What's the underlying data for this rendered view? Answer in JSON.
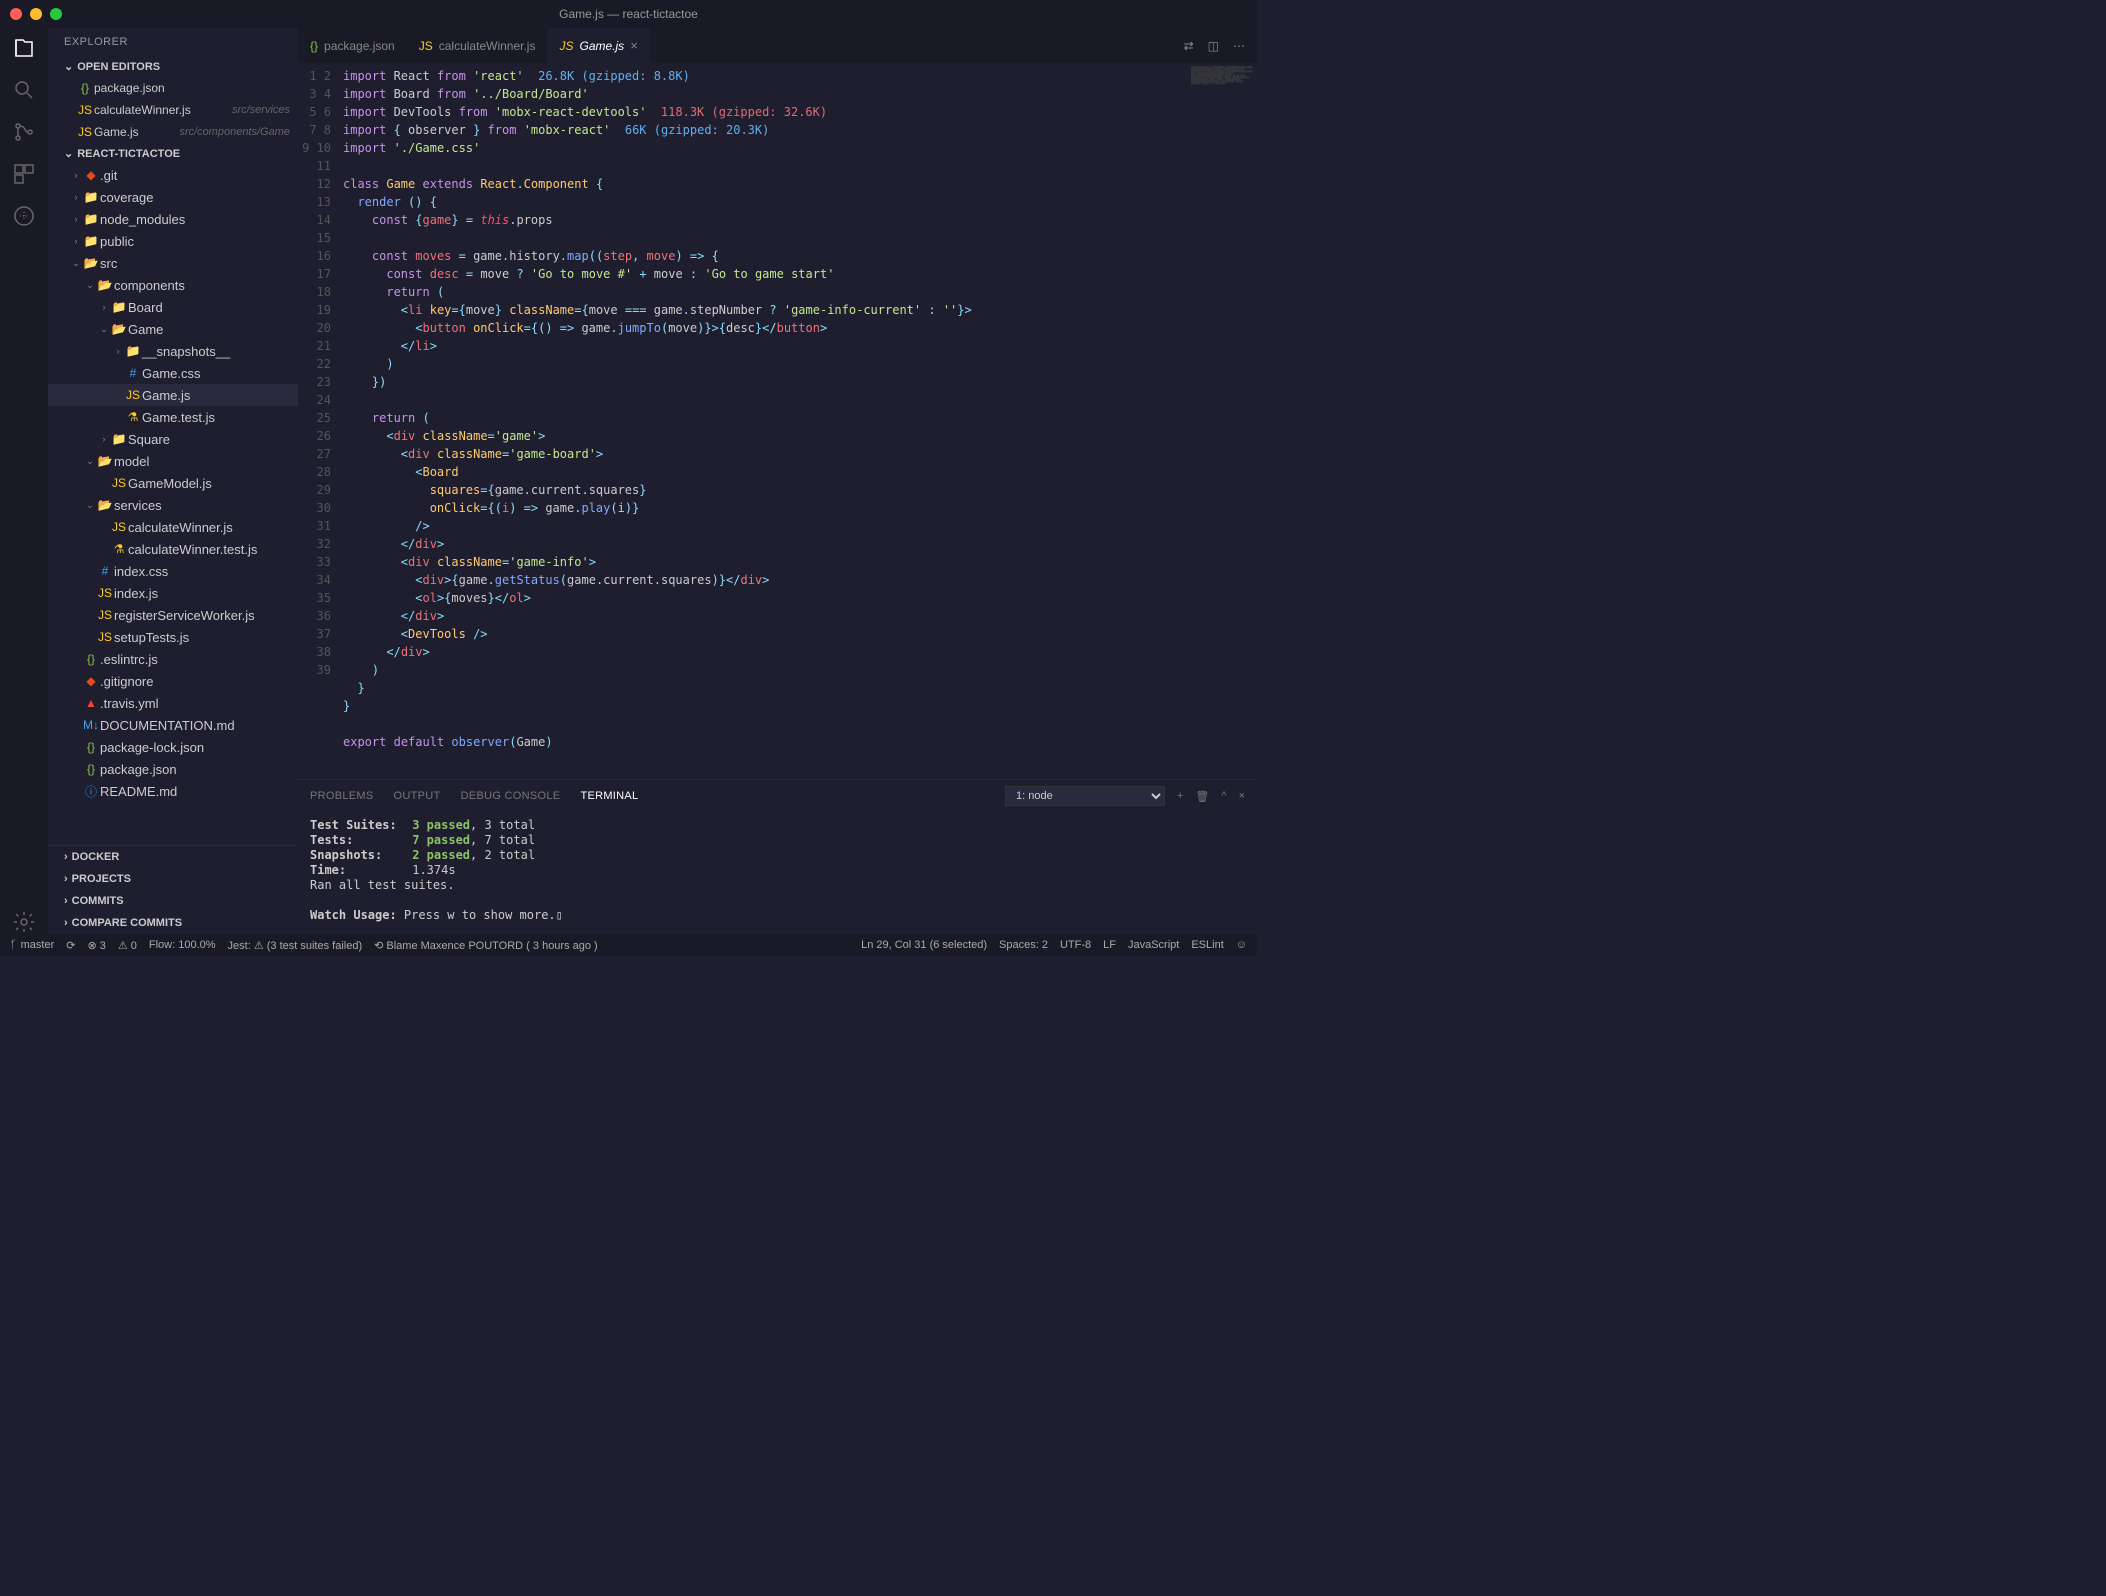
{
  "window_title": "Game.js — react-tictactoe",
  "explorer_title": "EXPLORER",
  "open_editors_title": "OPEN EDITORS",
  "open_editors": [
    {
      "icon": "json",
      "name": "package.json",
      "meta": ""
    },
    {
      "icon": "js",
      "name": "calculateWinner.js",
      "meta": "src/services"
    },
    {
      "icon": "js",
      "name": "Game.js",
      "meta": "src/components/Game"
    }
  ],
  "project_title": "REACT-TICTACTOE",
  "tree": [
    {
      "d": 1,
      "c": "›",
      "i": "git",
      "t": ".git"
    },
    {
      "d": 1,
      "c": "›",
      "i": "folder",
      "t": "coverage"
    },
    {
      "d": 1,
      "c": "›",
      "i": "folder",
      "t": "node_modules"
    },
    {
      "d": 1,
      "c": "›",
      "i": "folder",
      "t": "public"
    },
    {
      "d": 1,
      "c": "⌄",
      "i": "folder-open",
      "t": "src"
    },
    {
      "d": 2,
      "c": "⌄",
      "i": "folder-open",
      "t": "components"
    },
    {
      "d": 3,
      "c": "›",
      "i": "folder",
      "t": "Board"
    },
    {
      "d": 3,
      "c": "⌄",
      "i": "folder-open",
      "t": "Game"
    },
    {
      "d": 4,
      "c": "›",
      "i": "folder",
      "t": "__snapshots__"
    },
    {
      "d": 4,
      "c": "",
      "i": "css",
      "t": "Game.css"
    },
    {
      "d": 4,
      "c": "",
      "i": "js",
      "t": "Game.js",
      "sel": true
    },
    {
      "d": 4,
      "c": "",
      "i": "test",
      "t": "Game.test.js"
    },
    {
      "d": 3,
      "c": "›",
      "i": "folder",
      "t": "Square"
    },
    {
      "d": 2,
      "c": "⌄",
      "i": "folder-open",
      "t": "model"
    },
    {
      "d": 3,
      "c": "",
      "i": "js",
      "t": "GameModel.js"
    },
    {
      "d": 2,
      "c": "⌄",
      "i": "folder-open",
      "t": "services"
    },
    {
      "d": 3,
      "c": "",
      "i": "js",
      "t": "calculateWinner.js"
    },
    {
      "d": 3,
      "c": "",
      "i": "test",
      "t": "calculateWinner.test.js"
    },
    {
      "d": 2,
      "c": "",
      "i": "css",
      "t": "index.css"
    },
    {
      "d": 2,
      "c": "",
      "i": "js",
      "t": "index.js"
    },
    {
      "d": 2,
      "c": "",
      "i": "js",
      "t": "registerServiceWorker.js"
    },
    {
      "d": 2,
      "c": "",
      "i": "js",
      "t": "setupTests.js"
    },
    {
      "d": 1,
      "c": "",
      "i": "json",
      "t": ".eslintrc.js"
    },
    {
      "d": 1,
      "c": "",
      "i": "git",
      "t": ".gitignore"
    },
    {
      "d": 1,
      "c": "",
      "i": "yml",
      "t": ".travis.yml"
    },
    {
      "d": 1,
      "c": "",
      "i": "md",
      "t": "DOCUMENTATION.md"
    },
    {
      "d": 1,
      "c": "",
      "i": "json",
      "t": "package-lock.json"
    },
    {
      "d": 1,
      "c": "",
      "i": "json",
      "t": "package.json"
    },
    {
      "d": 1,
      "c": "",
      "i": "info",
      "t": "README.md"
    }
  ],
  "sidebar_bottom": [
    "DOCKER",
    "PROJECTS",
    "COMMITS",
    "COMPARE COMMITS"
  ],
  "tabs": [
    {
      "icon": "json",
      "label": "package.json"
    },
    {
      "icon": "js",
      "label": "calculateWinner.js"
    },
    {
      "icon": "js",
      "label": "Game.js",
      "active": true,
      "close": true
    }
  ],
  "code_lines": [
    "<span class='kw'>import</span> React <span class='kw'>from</span> <span class='str'>'react'</span>  <span class='hint3'>26.8K (gzipped: 8.8K)</span>",
    "<span class='kw'>import</span> Board <span class='kw'>from</span> <span class='str'>'../Board/Board'</span>",
    "<span class='kw'>import</span> DevTools <span class='kw'>from</span> <span class='str'>'mobx-react-devtools'</span>  <span class='hint2'>118.3K (gzipped: 32.6K)</span>",
    "<span class='kw'>import</span> <span class='op'>{</span> observer <span class='op'>}</span> <span class='kw'>from</span> <span class='str'>'mobx-react'</span>  <span class='hint3'>66K (gzipped: 20.3K)</span>",
    "<span class='kw'>import</span> <span class='str'>'./Game.css'</span>",
    "",
    "<span class='kw'>class</span> <span class='cls'>Game</span> <span class='kw'>extends</span> <span class='cls'>React</span><span class='op'>.</span><span class='cls'>Component</span> <span class='op'>{</span>",
    "  <span class='fn'>render</span> <span class='op'>() {</span>",
    "    <span class='kw'>const</span> <span class='op'>{</span><span class='var'>game</span><span class='op'>}</span> <span class='op'>=</span> <span class='this'>this</span><span class='op'>.</span>props",
    "",
    "    <span class='kw'>const</span> <span class='var'>moves</span> <span class='op'>=</span> game<span class='op'>.</span>history<span class='op'>.</span><span class='fn'>map</span><span class='op'>((</span><span class='var'>step</span><span class='op'>,</span> <span class='var'>move</span><span class='op'>) =&gt; {</span>",
    "      <span class='kw'>const</span> <span class='var'>desc</span> <span class='op'>=</span> move <span class='op'>?</span> <span class='str'>'Go to move #'</span> <span class='op'>+</span> move <span class='op'>:</span> <span class='str'>'Go to game start'</span>",
    "      <span class='kw'>return</span> <span class='op'>(</span>",
    "        <span class='op'>&lt;</span><span class='tag'>li</span> <span class='attr'>key</span><span class='op'>={</span>move<span class='op'>}</span> <span class='attr'>className</span><span class='op'>={</span>move <span class='op'>===</span> game<span class='op'>.</span>stepNumber <span class='op'>?</span> <span class='str'>'game-info-current'</span> <span class='op'>:</span> <span class='str'>''</span><span class='op'>}&gt;</span>",
    "          <span class='op'>&lt;</span><span class='tag'>button</span> <span class='attr'>onClick</span><span class='op'>={() =&gt;</span> game<span class='op'>.</span><span class='fn'>jumpTo</span><span class='op'>(</span>move<span class='op'>)}&gt;{</span>desc<span class='op'>}&lt;/</span><span class='tag'>button</span><span class='op'>&gt;</span>",
    "        <span class='op'>&lt;/</span><span class='tag'>li</span><span class='op'>&gt;</span>",
    "      <span class='op'>)</span>",
    "    <span class='op'>})</span>",
    "",
    "    <span class='kw'>return</span> <span class='op'>(</span>",
    "      <span class='op'>&lt;</span><span class='tag'>div</span> <span class='attr'>className</span><span class='op'>=</span><span class='str'>'game'</span><span class='op'>&gt;</span>",
    "        <span class='op'>&lt;</span><span class='tag'>div</span> <span class='attr'>className</span><span class='op'>=</span><span class='str'>'game-board'</span><span class='op'>&gt;</span>",
    "          <span class='op'>&lt;</span><span class='cls'>Board</span>",
    "            <span class='attr'>squares</span><span class='op'>={</span>game<span class='op'>.</span>current<span class='op'>.</span>squares<span class='op'>}</span>",
    "            <span class='attr'>onClick</span><span class='op'>={(</span><span class='var'>i</span><span class='op'>) =&gt;</span> game<span class='op'>.</span><span class='fn'>play</span><span class='op'>(</span>i<span class='op'>)}</span>",
    "          <span class='op'>/&gt;</span>",
    "        <span class='op'>&lt;/</span><span class='tag'>div</span><span class='op'>&gt;</span>",
    "        <span class='op'>&lt;</span><span class='tag'>div</span> <span class='attr'>className</span><span class='op'>=</span><span class='str'>'game-info'</span><span class='op'>&gt;</span>",
    "          <span class='op'>&lt;</span><span class='tag'>div</span><span class='op'>&gt;{</span>game<span class='op'>.</span><span class='fn'>getStatus</span><span class='op'>(</span>game<span class='op'>.</span>current<span class='op'>.</span>squares<span class='op'>)}&lt;/</span><span class='tag'>div</span><span class='op'>&gt;</span>",
    "          <span class='op'>&lt;</span><span class='tag'>ol</span><span class='op'>&gt;{</span>moves<span class='op'>}&lt;/</span><span class='tag'>ol</span><span class='op'>&gt;</span>",
    "        <span class='op'>&lt;/</span><span class='tag'>div</span><span class='op'>&gt;</span>",
    "        <span class='op'>&lt;</span><span class='cls'>DevTools</span> <span class='op'>/&gt;</span>",
    "      <span class='op'>&lt;/</span><span class='tag'>div</span><span class='op'>&gt;</span>",
    "    <span class='op'>)</span>",
    "  <span class='op'>}</span>",
    "<span class='op'>}</span>",
    "",
    "<span class='kw'>export</span> <span class='kw'>default</span> <span class='fn'>observer</span><span class='op'>(</span>Game<span class='op'>)</span>",
    ""
  ],
  "panel_tabs": [
    "PROBLEMS",
    "OUTPUT",
    "DEBUG CONSOLE",
    "TERMINAL"
  ],
  "panel_active": "TERMINAL",
  "terminal_select": "1: node",
  "terminal_lines": [
    "<span class='lbl2'>Test Suites:</span> <span class='pass'>3 passed</span>, 3 total",
    "<span class='lbl2'>Tests:</span> <span class='pass'>7 passed</span>, 7 total",
    "<span class='lbl2'>Snapshots:</span> <span class='pass'>2 passed</span>, 2 total",
    "<span class='lbl2'>Time:</span> 1.374s",
    "Ran all test suites.",
    "",
    "<b>Watch Usage:</b> Press w to show more.▯"
  ],
  "status": {
    "branch": "master",
    "errors": "⊗ 3",
    "warnings": "⚠ 0",
    "flow": "Flow: 100.0%",
    "jest": "Jest: ⚠  (3 test suites failed)",
    "blame": "⟲ Blame Maxence POUTORD ( 3 hours ago )",
    "pos": "Ln 29, Col 31 (6 selected)",
    "spaces": "Spaces: 2",
    "enc": "UTF-8",
    "eol": "LF",
    "lang": "JavaScript",
    "lint": "ESLint",
    "smile": "☺"
  }
}
